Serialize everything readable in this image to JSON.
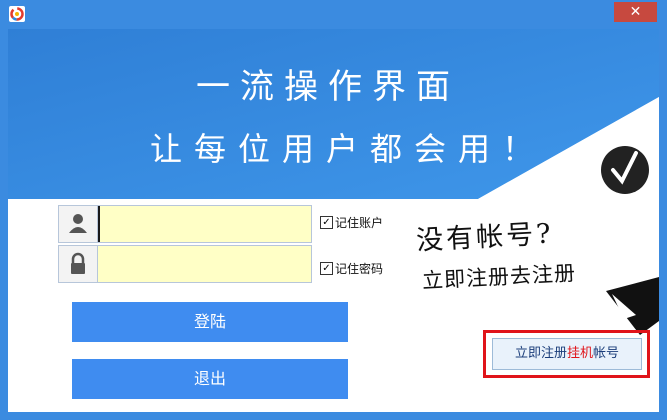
{
  "window": {
    "close_label": "✕"
  },
  "banner": {
    "slogan_line1": "一流操作界面",
    "slogan_line2": "让每位用户都会用！"
  },
  "login": {
    "account_value": "",
    "password_value": "",
    "remember_account_label": "记住账户",
    "remember_password_label": "记住密码",
    "remember_account_checked": true,
    "remember_password_checked": true,
    "login_label": "登陆",
    "exit_label": "退出"
  },
  "promo": {
    "line1": "没有帐号?",
    "line2": "立即注册去注册"
  },
  "register": {
    "label_prefix": "立即注册",
    "label_highlight": "挂机",
    "label_suffix": "帐号"
  },
  "icons": {
    "app": "app-logo-icon",
    "user": "user-icon",
    "lock": "lock-icon",
    "badge": "checkmark-badge-icon",
    "arrow": "arrow-icon"
  },
  "colors": {
    "frame": "#3b8be0",
    "button": "#3f8cf0",
    "input_bg": "#ffffc6",
    "close": "#c7493f",
    "highlight": "#e0141a"
  }
}
